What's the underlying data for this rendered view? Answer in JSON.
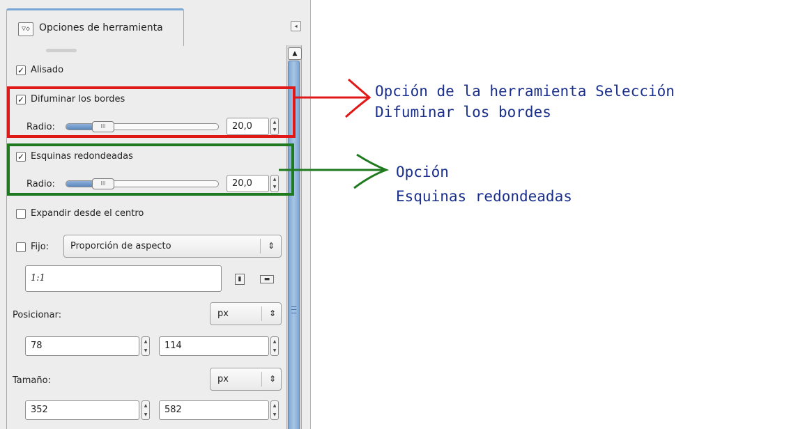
{
  "panel": {
    "tab_title": "Opciones de herramienta",
    "tab_icon": "tool-options-icon",
    "dock_menu_icon": "dock-menu-icon"
  },
  "options": {
    "antialiasing": {
      "label": "Alisado",
      "checked": true
    },
    "feather_edges": {
      "label": "Difuminar los bordes",
      "checked": true,
      "radius_label": "Radio:",
      "radius_value": "20,0",
      "slider_level": 0.2
    },
    "rounded_corners": {
      "label": "Esquinas redondeadas",
      "checked": true,
      "radius_label": "Radio:",
      "radius_value": "20,0",
      "slider_level": 0.2
    },
    "expand_from_center": {
      "label": "Expandir desde el centro",
      "checked": false
    },
    "fixed": {
      "label": "Fijo:",
      "checked": false,
      "mode": "Proporción de aspecto",
      "ratio_value": "1:1"
    },
    "position": {
      "label": "Posicionar:",
      "unit": "px",
      "x": "78",
      "y": "114"
    },
    "size": {
      "label": "Tamaño:",
      "unit": "px",
      "w": "352",
      "h": "582"
    }
  },
  "annotations": {
    "feather": {
      "line1": "Opción de la herramienta Selección",
      "line2": "Difuminar los bordes",
      "color": "#e01818"
    },
    "rounded": {
      "line1": "Opción",
      "line2": "Esquinas redondeadas",
      "color": "#1f7a1f"
    },
    "text_color": "#1a2f8c"
  }
}
